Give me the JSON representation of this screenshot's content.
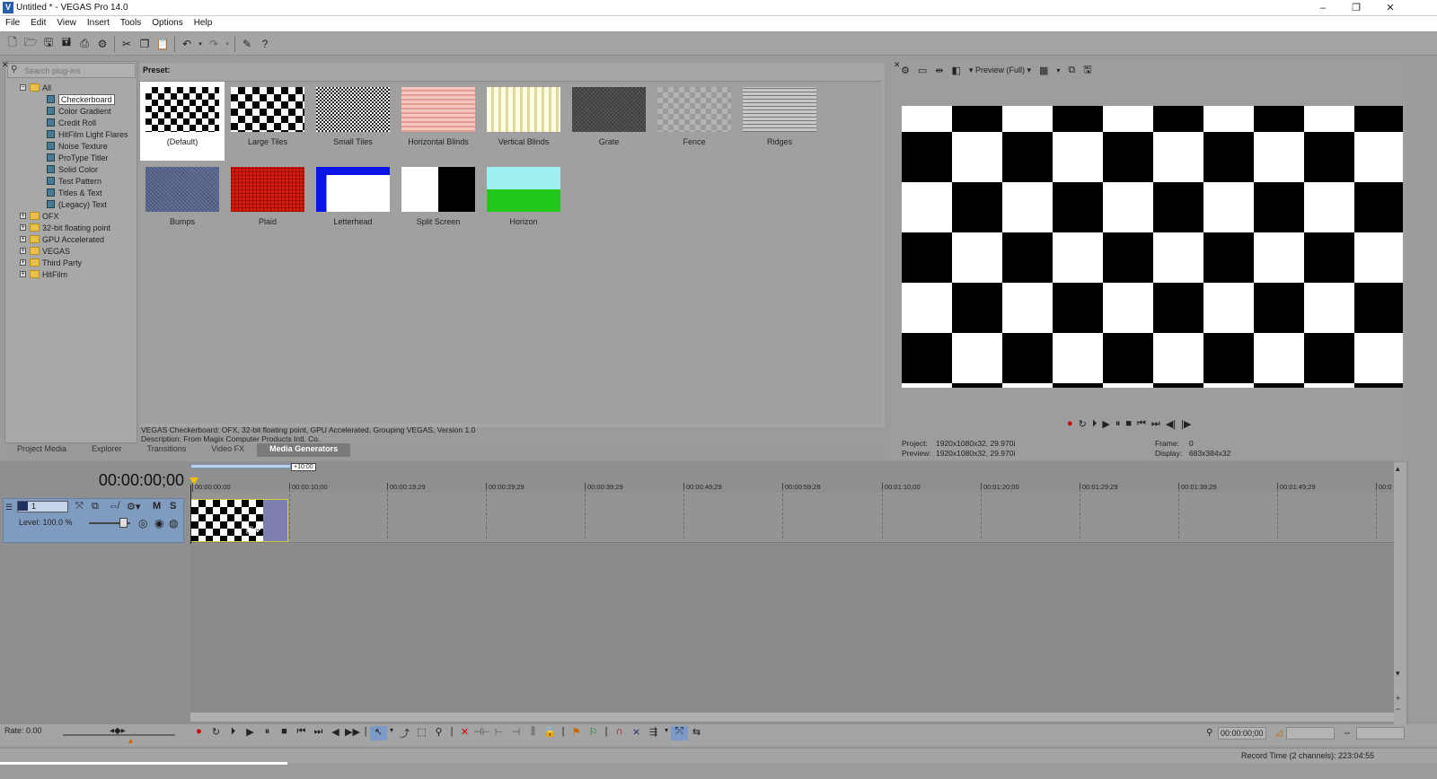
{
  "window": {
    "title": "Untitled * - VEGAS Pro 14.0",
    "icon": "vegas-logo",
    "minimize": "–",
    "restore": "❐",
    "close": "✕"
  },
  "menu": [
    "File",
    "Edit",
    "View",
    "Insert",
    "Tools",
    "Options",
    "Help"
  ],
  "plugin_browser": {
    "search_placeholder": "Search plug-ins",
    "root": "All",
    "items": [
      "Checkerboard",
      "Color Gradient",
      "Credit Roll",
      "HitFilm Light Flares",
      "Noise Texture",
      "ProType Titler",
      "Solid Color",
      "Test Pattern",
      "Titles & Text",
      "(Legacy) Text"
    ],
    "selected": "Checkerboard",
    "folders": [
      "OFX",
      "32-bit floating point",
      "GPU Accelerated",
      "VEGAS",
      "Third Party",
      "HitFilm"
    ]
  },
  "presets": {
    "label": "Preset:",
    "row1": [
      "(Default)",
      "Large Tiles",
      "Small Tiles",
      "Horizontal Blinds",
      "Vertical Blinds",
      "Grate",
      "Fence",
      "Ridges"
    ],
    "row2": [
      "Bumps",
      "Plaid",
      "Letterhead",
      "Split Screen",
      "Horizon"
    ]
  },
  "description": {
    "line1": "VEGAS Checkerboard: OFX, 32-bit floating point, GPU Accelerated, Grouping VEGAS, Version 1.0",
    "line2": "Description: From Magix Computer Products Intl. Co."
  },
  "tabs": [
    "Project Media",
    "Explorer",
    "Transitions",
    "Video FX",
    "Media Generators"
  ],
  "active_tab": "Media Generators",
  "preview": {
    "mode": "Preview (Full)",
    "project_label": "Project:",
    "project_value": "1920x1080x32, 29.970i",
    "preview_label": "Preview:",
    "preview_value": "1920x1080x32, 29.970i",
    "frame_label": "Frame:",
    "frame_value": "0",
    "display_label": "Display:",
    "display_value": "683x384x32"
  },
  "timeline": {
    "timecode": "00:00:00;00",
    "loop_badge": "+10:00",
    "ruler": [
      "00:00:00;00",
      "00:00:10;00",
      "00:00:19;29",
      "00:00:29;29",
      "00:00:39;29",
      "00:00:49;29",
      "00:00:59;28",
      "00:01:10;00",
      "00:01:20;00",
      "00:01:29;29",
      "00:01:39;29",
      "00:01:49;29",
      "00:0"
    ],
    "track_number": "1",
    "track_level": "Level: 100.0 %",
    "mute": "M",
    "solo": "S"
  },
  "transport": {
    "rate": "Rate: 0.00",
    "cursor_time": "00:00:00;00"
  },
  "status": {
    "record_time": "Record Time (2 channels): 223:04:55"
  }
}
